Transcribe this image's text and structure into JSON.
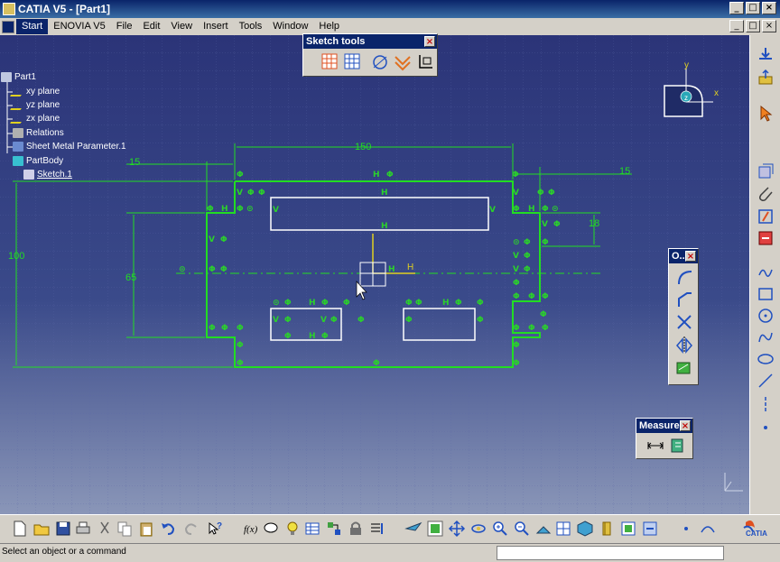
{
  "window": {
    "title": "CATIA V5 - [Part1]",
    "minimize": "_",
    "restore": "□",
    "close": "×"
  },
  "menu": {
    "items": [
      "Start",
      "ENOVIA V5",
      "File",
      "Edit",
      "View",
      "Insert",
      "Tools",
      "Window",
      "Help"
    ],
    "active": "Start",
    "doc_minimize": "_",
    "doc_restore": "□",
    "doc_close": "×"
  },
  "tree": {
    "items": [
      {
        "label": "Part1",
        "icon": "part-icon"
      },
      {
        "label": "xy plane",
        "icon": "plane-icon"
      },
      {
        "label": "yz plane",
        "icon": "plane-icon"
      },
      {
        "label": "zx plane",
        "icon": "plane-icon"
      },
      {
        "label": "Relations",
        "icon": "relations-icon"
      },
      {
        "label": "Sheet Metal Parameter.1",
        "icon": "sheet-metal-icon"
      },
      {
        "label": "PartBody",
        "icon": "body-icon"
      },
      {
        "label": "Sketch.1",
        "icon": "sketch-icon"
      }
    ]
  },
  "sketch_tools": {
    "title": "Sketch tools",
    "close": "×",
    "buttons": [
      "snap-grid-icon",
      "construction-grid-icon",
      "geometric-constraints-icon",
      "dimensional-constraints-icon",
      "auto-constraint-icon"
    ]
  },
  "profile_tb": {
    "title": "O...",
    "close": "×",
    "buttons": [
      "corner-icon",
      "chamfer-icon",
      "trim-icon",
      "mirror-icon",
      "project-3d-icon"
    ]
  },
  "measure_tb": {
    "title": "Measure",
    "close": "×",
    "buttons": [
      "measure-between-icon",
      "measure-item-icon"
    ]
  },
  "compass": {
    "x": "x",
    "y": "y",
    "z": "z"
  },
  "dimensions": {
    "width_top": "150",
    "left_step": "15",
    "right_step": "15",
    "height_total": "100",
    "height_inner": "65",
    "right_notch": "18"
  },
  "sketch_labels": {
    "h_axis": "H",
    "v_axis": "V"
  },
  "status": {
    "text": "Select an object or a command",
    "command_value": ""
  },
  "brand": {
    "logo_text": "CATIA"
  },
  "colors": {
    "viewport_top": "#2b3478",
    "viewport_bottom": "#8a96b8",
    "geometry": "#22dd22",
    "constraint": "#2bd12b",
    "profile_white": "#ffffff",
    "axis_yellow": "#e0d020"
  }
}
